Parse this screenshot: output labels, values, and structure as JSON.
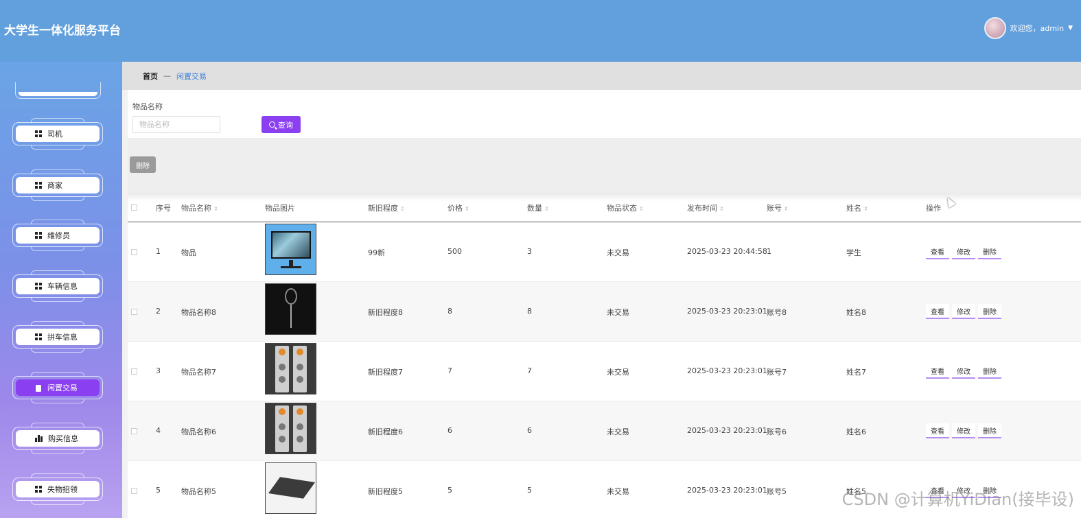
{
  "header": {
    "title": "大学生一体化服务平台",
    "welcome": "欢迎您，admin"
  },
  "sidebar": {
    "items": [
      {
        "label": "司机",
        "icon": "grid-icon",
        "active": false
      },
      {
        "label": "商家",
        "icon": "grid-icon",
        "active": false
      },
      {
        "label": "维修员",
        "icon": "grid-icon",
        "active": false
      },
      {
        "label": "车辆信息",
        "icon": "grid-icon",
        "active": false
      },
      {
        "label": "拼车信息",
        "icon": "grid-icon",
        "active": false
      },
      {
        "label": "闲置交易",
        "icon": "clipboard-icon",
        "active": true
      },
      {
        "label": "购买信息",
        "icon": "bar-chart-icon",
        "active": false
      },
      {
        "label": "失物招领",
        "icon": "grid-icon",
        "active": false
      }
    ]
  },
  "breadcrumb": {
    "home": "首页",
    "separator": "—",
    "current": "闲置交易"
  },
  "search": {
    "label": "物品名称",
    "placeholder": "物品名称",
    "button": "查询"
  },
  "actions": {
    "batch_delete": "删除"
  },
  "table": {
    "columns": [
      "序号",
      "物品名称",
      "物品图片",
      "新旧程度",
      "价格",
      "数量",
      "物品状态",
      "发布时间",
      "账号",
      "姓名",
      "操作"
    ],
    "rows": [
      {
        "index": "1",
        "name": "物品",
        "image": "monitor-image",
        "condition": "99新",
        "price": "500",
        "quantity": "3",
        "status": "未交易",
        "time": "2025-03-23 20:44:58",
        "account": "1",
        "owner": "学生"
      },
      {
        "index": "2",
        "name": "物品名称8",
        "image": "badminton-racket-image",
        "condition": "新旧程度8",
        "price": "8",
        "quantity": "8",
        "status": "未交易",
        "time": "2025-03-23 20:23:01",
        "account": "账号8",
        "owner": "姓名8"
      },
      {
        "index": "3",
        "name": "物品名称7",
        "image": "speaker-image",
        "condition": "新旧程度7",
        "price": "7",
        "quantity": "7",
        "status": "未交易",
        "time": "2025-03-23 20:23:01",
        "account": "账号7",
        "owner": "姓名7"
      },
      {
        "index": "4",
        "name": "物品名称6",
        "image": "speaker-image",
        "condition": "新旧程度6",
        "price": "6",
        "quantity": "6",
        "status": "未交易",
        "time": "2025-03-23 20:23:01",
        "account": "账号6",
        "owner": "姓名6"
      },
      {
        "index": "5",
        "name": "物品名称5",
        "image": "laptop-image",
        "condition": "新旧程度5",
        "price": "5",
        "quantity": "5",
        "status": "未交易",
        "time": "2025-03-23 20:23:01",
        "account": "账号5",
        "owner": "姓名5"
      }
    ],
    "row_actions": {
      "view": "查看",
      "edit": "修改",
      "delete": "删除"
    }
  },
  "watermark": "CSDN @计算机YiDian(接毕设)",
  "colors": {
    "header": "#62a0dd",
    "accent": "#8a3ff0",
    "link": "#3c7fd6"
  }
}
